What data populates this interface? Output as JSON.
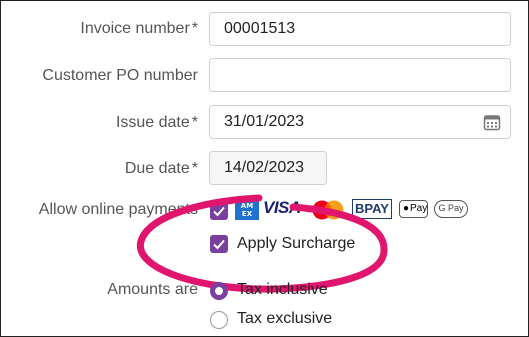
{
  "form": {
    "invoice_number": {
      "label": "Invoice number",
      "required_mark": "*",
      "value": "00001513"
    },
    "customer_po": {
      "label": "Customer PO number",
      "value": ""
    },
    "issue_date": {
      "label": "Issue date",
      "required_mark": "*",
      "value": "31/01/2023",
      "icon": "calendar-icon"
    },
    "due_date": {
      "label": "Due date",
      "required_mark": "*",
      "value": "14/02/2023"
    },
    "online_payments": {
      "label": "Allow online payments",
      "checked": true,
      "methods": [
        "American Express",
        "VISA",
        "Mastercard",
        "BPAY",
        "Apple Pay",
        "Google Pay"
      ],
      "logo_text": {
        "amex": "AM EX",
        "visa": "VISA",
        "bpay": "BPAY",
        "applepay": "Pay",
        "googlepay": "G Pay"
      }
    },
    "surcharge": {
      "label": "Apply Surcharge",
      "checked": true
    },
    "amounts": {
      "label": "Amounts are",
      "options": [
        {
          "label": "Tax inclusive",
          "selected": true
        },
        {
          "label": "Tax exclusive",
          "selected": false
        }
      ]
    }
  },
  "colors": {
    "accent": "#7b3fa0",
    "highlight": "#e0156e"
  }
}
